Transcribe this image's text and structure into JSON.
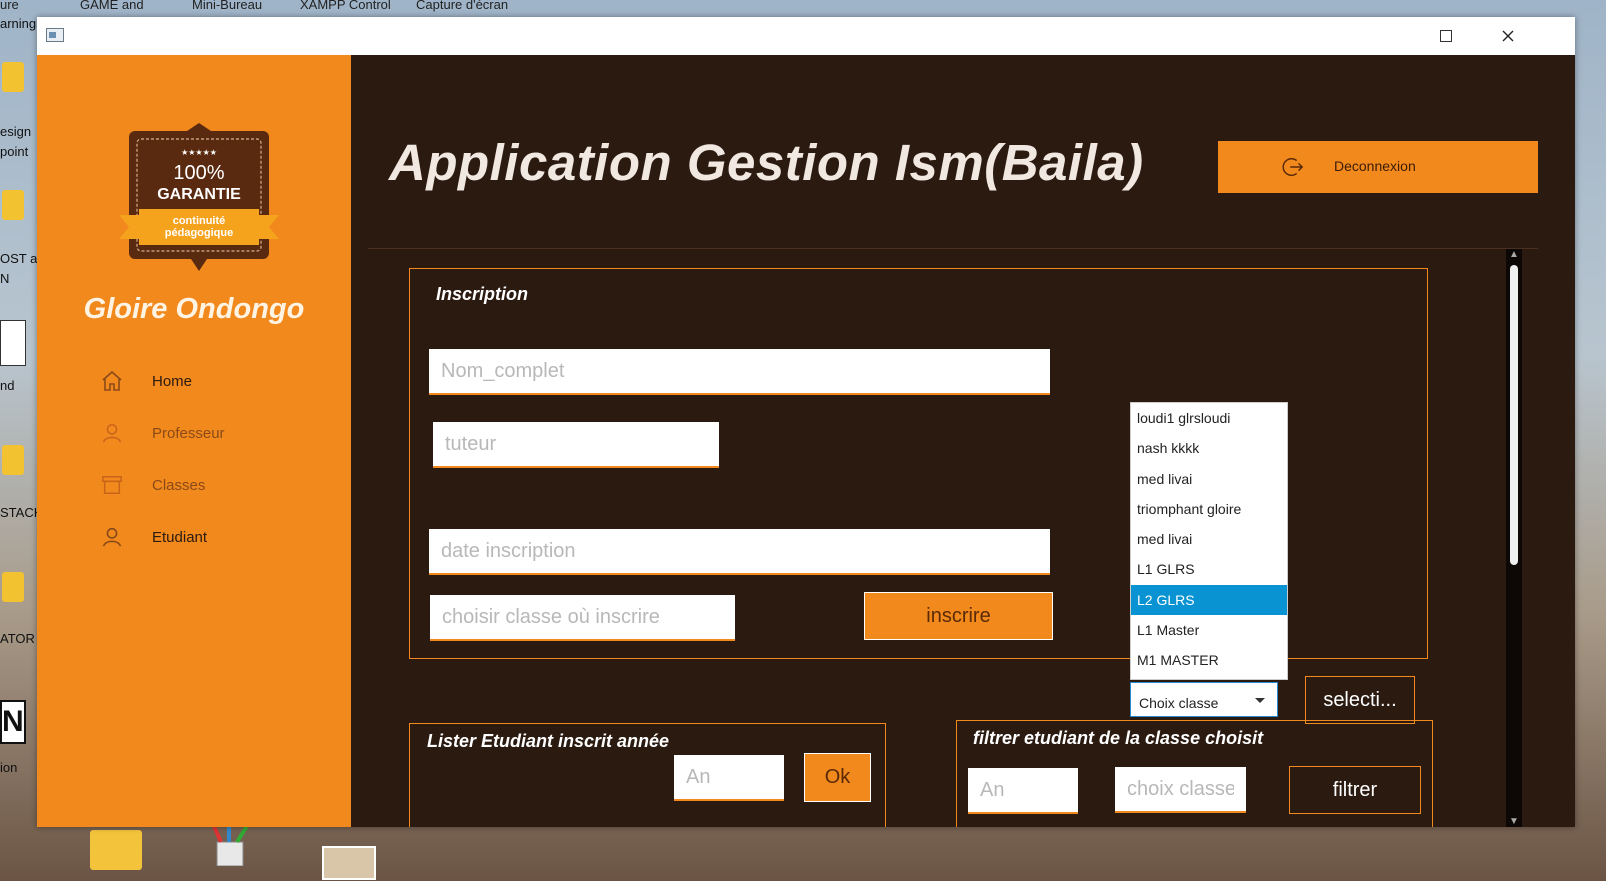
{
  "desktop": {
    "top_labels": [
      "ure",
      "GAME and",
      "Mini-Bureau",
      "XAMPP Control",
      "Capture d'écran"
    ],
    "left_labels": [
      "arning",
      "esign",
      "point",
      "OST a",
      "N",
      "nd",
      "STACK",
      "ATOR",
      "ion"
    ]
  },
  "window": {
    "maximize_icon": "maximize-icon",
    "close_icon": "close-icon"
  },
  "sidebar": {
    "badge": {
      "stars": "★★★★★",
      "percent": "100%",
      "label": "GARANTIE",
      "ribbon_line1": "continuité",
      "ribbon_line2": "pédagogique"
    },
    "user_name": "Gloire Ondongo",
    "nav": [
      {
        "label": "Home",
        "icon": "home-icon"
      },
      {
        "label": "Professeur",
        "icon": "user-icon"
      },
      {
        "label": "Classes",
        "icon": "archive-icon"
      },
      {
        "label": "Etudiant",
        "icon": "user-icon"
      }
    ]
  },
  "header": {
    "title": "Application Gestion Ism(Baila)",
    "logout_label": "Deconnexion"
  },
  "inscription": {
    "title": "Inscription",
    "nom_placeholder": "Nom_complet",
    "tuteur_placeholder": "tuteur",
    "date_placeholder": "date inscription",
    "classe_placeholder": "choisir classe où inscrire",
    "submit_label": "inscrire"
  },
  "dropdown": {
    "options": [
      "loudi1 glrsloudi",
      "nash kkkk",
      "med livai",
      "triomphant gloire",
      "med livai",
      "L1 GLRS",
      "L2 GLRS",
      "L1 Master",
      "M1 MASTER"
    ],
    "highlighted": "L2 GLRS",
    "combo_value": "Choix classe",
    "select_button": "selecti..."
  },
  "lister": {
    "title": "Lister Etudiant inscrit année",
    "an_placeholder": "An",
    "ok_label": "Ok"
  },
  "filtrer": {
    "title": "filtrer etudiant de la classe choisit",
    "an_placeholder": "An",
    "classe_placeholder": "choix classe",
    "button_label": "filtrer"
  },
  "colors": {
    "accent": "#f2891d",
    "background": "#2b1a10",
    "highlight": "#0a93d2"
  }
}
